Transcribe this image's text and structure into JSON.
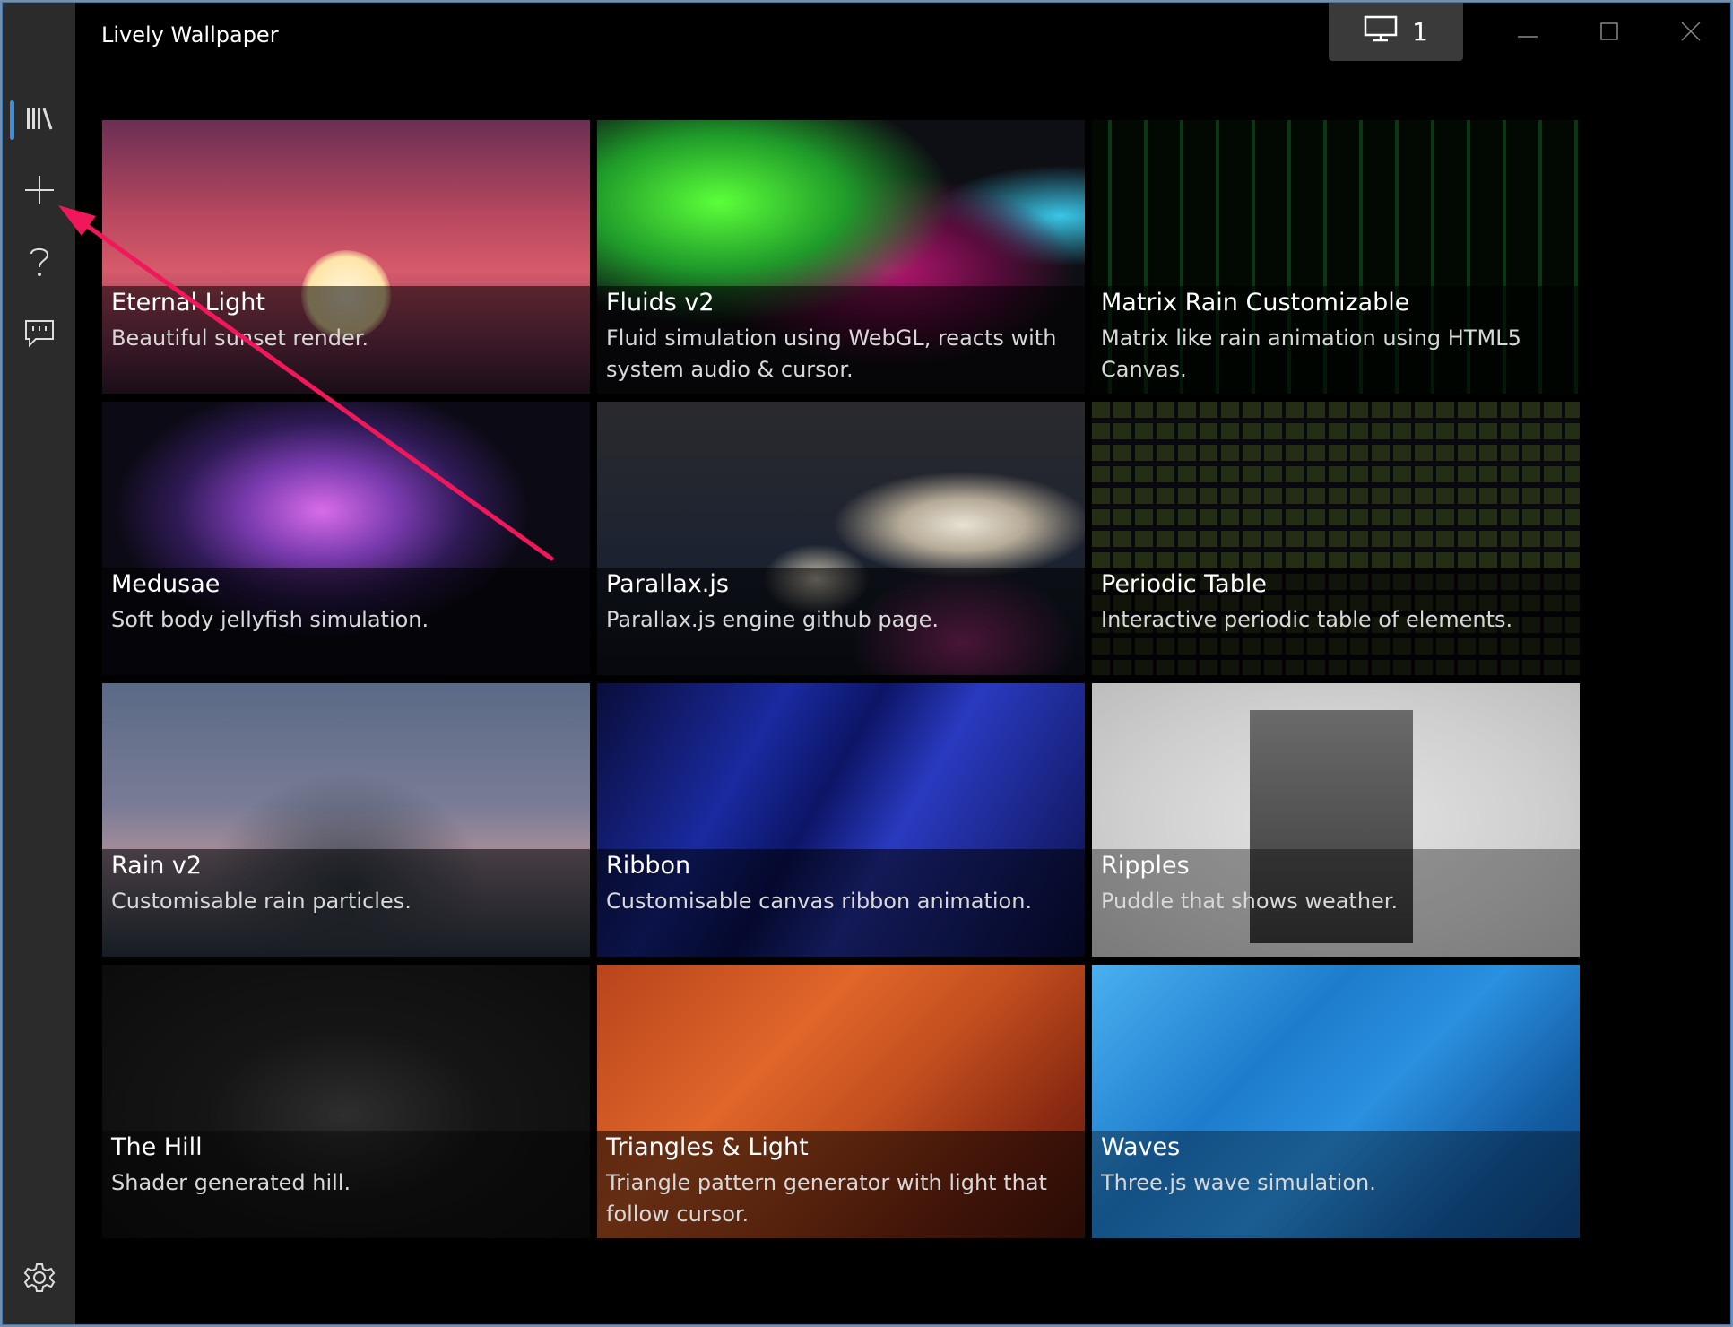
{
  "app": {
    "title": "Lively Wallpaper",
    "monitor_label": "1"
  },
  "sidebar": {
    "items": [
      {
        "name": "library",
        "icon": "library-icon"
      },
      {
        "name": "add",
        "icon": "plus-icon"
      },
      {
        "name": "help",
        "icon": "question-icon"
      },
      {
        "name": "feedback",
        "icon": "chat-icon"
      },
      {
        "name": "settings",
        "icon": "gear-icon"
      }
    ]
  },
  "wallpapers": [
    {
      "title": "Eternal Light",
      "description": "Beautiful sunset render."
    },
    {
      "title": "Fluids v2",
      "description": "Fluid simulation using WebGL, reacts with system audio & cursor."
    },
    {
      "title": "Matrix Rain Customizable",
      "description": "Matrix like rain animation using HTML5 Canvas."
    },
    {
      "title": "Medusae",
      "description": "Soft body jellyfish simulation."
    },
    {
      "title": "Parallax.js",
      "description": "Parallax.js engine github page."
    },
    {
      "title": "Periodic Table",
      "description": "Interactive periodic table of elements."
    },
    {
      "title": "Rain v2",
      "description": "Customisable rain particles."
    },
    {
      "title": "Ribbon",
      "description": "Customisable canvas ribbon animation."
    },
    {
      "title": "Ripples",
      "description": "Puddle that shows weather."
    },
    {
      "title": "The Hill",
      "description": "Shader generated hill."
    },
    {
      "title": "Triangles & Light",
      "description": "Triangle pattern generator with light that follow cursor."
    },
    {
      "title": "Waves",
      "description": "Three.js wave simulation."
    }
  ],
  "colors": {
    "accent": "#1f78d1",
    "annotation_arrow": "#f0185a"
  }
}
